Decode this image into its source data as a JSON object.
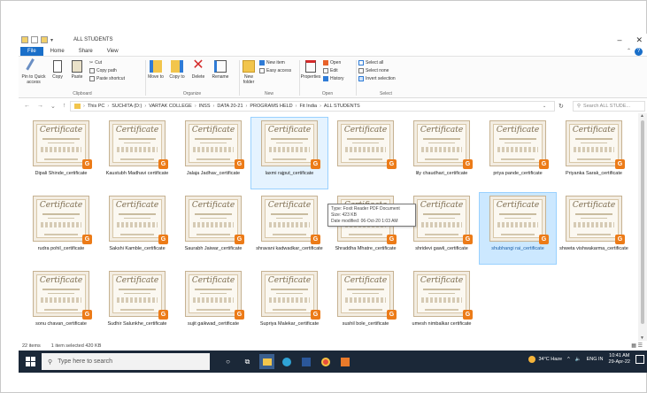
{
  "window": {
    "title": "ALL STUDENTS",
    "minimize": "–",
    "close": "✕"
  },
  "tabs": [
    "File",
    "Home",
    "Share",
    "View"
  ],
  "ribbon": {
    "clipboard": {
      "pin_label": "Pin to Quick access",
      "copy_label": "Copy",
      "paste_label": "Paste",
      "cut": "Cut",
      "copy_path": "Copy path",
      "paste_shortcut": "Paste shortcut",
      "group": "Clipboard"
    },
    "organize": {
      "move_to": "Move to",
      "copy_to": "Copy to",
      "delete": "Delete",
      "rename": "Rename",
      "group": "Organize"
    },
    "new": {
      "new_folder": "New folder",
      "new_item": "New item",
      "easy_access": "Easy access",
      "group": "New"
    },
    "open": {
      "properties": "Properties",
      "open": "Open",
      "edit": "Edit",
      "history": "History",
      "group": "Open"
    },
    "select": {
      "select_all": "Select all",
      "select_none": "Select none",
      "invert": "Invert selection",
      "group": "Select"
    }
  },
  "address": {
    "crumbs": [
      "This PC",
      "SUCHITA (D:)",
      "VARTAK COLLEGE",
      "INSS",
      "DATA 20-21",
      "PROGRAMS HELD",
      "Fit India",
      "ALL STUDENTS"
    ],
    "search_placeholder": "Search ALL STUDE..."
  },
  "files": [
    {
      "name": "Dipali Shinde_certificate",
      "state": ""
    },
    {
      "name": "Kaustubh Madhavi certificate",
      "state": ""
    },
    {
      "name": "Jalaja Jadhav_certificate",
      "state": ""
    },
    {
      "name": "laxmi rajput_certificate",
      "state": "hover"
    },
    {
      "name": "",
      "state": ""
    },
    {
      "name": "lily chaudhari_certificate",
      "state": ""
    },
    {
      "name": "priya pande_certificate",
      "state": ""
    },
    {
      "name": "Priyanka Sarak_certificate",
      "state": ""
    },
    {
      "name": "rudra pohil_certificate",
      "state": ""
    },
    {
      "name": "Sakshi Kamble_certificate",
      "state": ""
    },
    {
      "name": "Saurabh Jaiwar_certificate",
      "state": ""
    },
    {
      "name": "shravani kadwadkar_certificate",
      "state": ""
    },
    {
      "name": "Shraddha Mhatre_certificate",
      "state": ""
    },
    {
      "name": "shridevi gawli_certificate",
      "state": ""
    },
    {
      "name": "shubhangi rai_certificate",
      "state": "selected"
    },
    {
      "name": "shweta vishwakarma_certificate",
      "state": ""
    },
    {
      "name": "sonu chavan_certificate",
      "state": ""
    },
    {
      "name": "Sudhir Salunkhe_certificate",
      "state": ""
    },
    {
      "name": "sujit gaikwad_certificate",
      "state": ""
    },
    {
      "name": "Supriya Malekar_certificate",
      "state": ""
    },
    {
      "name": "sushil bole_certificate",
      "state": ""
    },
    {
      "name": "umesh nimbalkar certificate",
      "state": ""
    }
  ],
  "certificate_text": "Certificate",
  "badge_glyph": "G",
  "tooltip": {
    "type": "Type: Foxit Reader PDF Document",
    "size": "Size: 423 KB",
    "modified": "Date modified: 06-Oct-20 1:03 AM"
  },
  "status": {
    "items": "22 items",
    "selected": "1 item selected 420 KB"
  },
  "taskbar": {
    "search_placeholder": "Type here to search",
    "weather": "34°C Haze",
    "lang": "ENG IN",
    "time": "10:41 AM",
    "date": "29-Apr-22"
  },
  "colors": {
    "file_tab": "#1a6fc9",
    "taskbar": "#1b2838",
    "badge": "#ec7b18",
    "selection": "#cce8ff"
  }
}
